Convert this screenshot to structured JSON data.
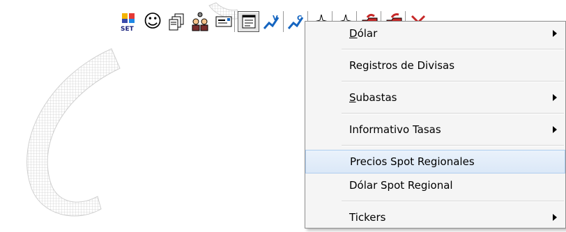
{
  "toolbar": {
    "buttons": [
      {
        "name": "set-logo-button",
        "icon": "set-logo-icon",
        "label": "SET"
      },
      {
        "name": "smiley-button",
        "icon": "smiley-icon",
        "glyph": "☺"
      },
      {
        "name": "documents-stack-button",
        "icon": "documents-stack-icon"
      },
      {
        "name": "users-network-button",
        "icon": "users-network-icon"
      },
      {
        "name": "message-card-button",
        "icon": "message-card-icon"
      },
      {
        "name": "window-list-button",
        "icon": "window-list-icon"
      },
      {
        "name": "chart-v-button",
        "icon": "chart-v-icon",
        "letter": "V"
      },
      {
        "name": "chart-c-button",
        "icon": "chart-c-icon",
        "letter": "C"
      },
      {
        "name": "spark-up-button",
        "icon": "spark-up-icon"
      },
      {
        "name": "spark-down-button",
        "icon": "spark-down-icon"
      },
      {
        "name": "red-folder-up-button",
        "icon": "red-folder-up-icon"
      },
      {
        "name": "red-folder-down-button",
        "icon": "red-folder-down-icon"
      },
      {
        "name": "red-close-button",
        "icon": "close-icon"
      }
    ]
  },
  "menu": {
    "items": [
      {
        "label_pre": "",
        "label_u": "D",
        "label_post": "ólar",
        "submenu": true
      },
      {
        "label_pre": "Registros de Divisas",
        "label_u": "",
        "label_post": "",
        "submenu": false
      },
      {
        "label_pre": "",
        "label_u": "S",
        "label_post": "ubastas",
        "submenu": true
      },
      {
        "label_pre": "Informativo Tasas",
        "label_u": "",
        "label_post": "",
        "submenu": true
      },
      {
        "label_pre": "Precios Spot Regionales",
        "label_u": "",
        "label_post": "",
        "submenu": false,
        "highlighted": true
      },
      {
        "label_pre": "Dólar Spot Regional",
        "label_u": "",
        "label_post": "",
        "submenu": false
      },
      {
        "label_pre": "Tickers",
        "label_u": "",
        "label_post": "",
        "submenu": true
      }
    ]
  },
  "colors": {
    "menu_bg": "#f5f5f5",
    "highlight": "#dbe8f7",
    "highlight_border": "#aecdef",
    "watermark": "#d6d6d6"
  }
}
